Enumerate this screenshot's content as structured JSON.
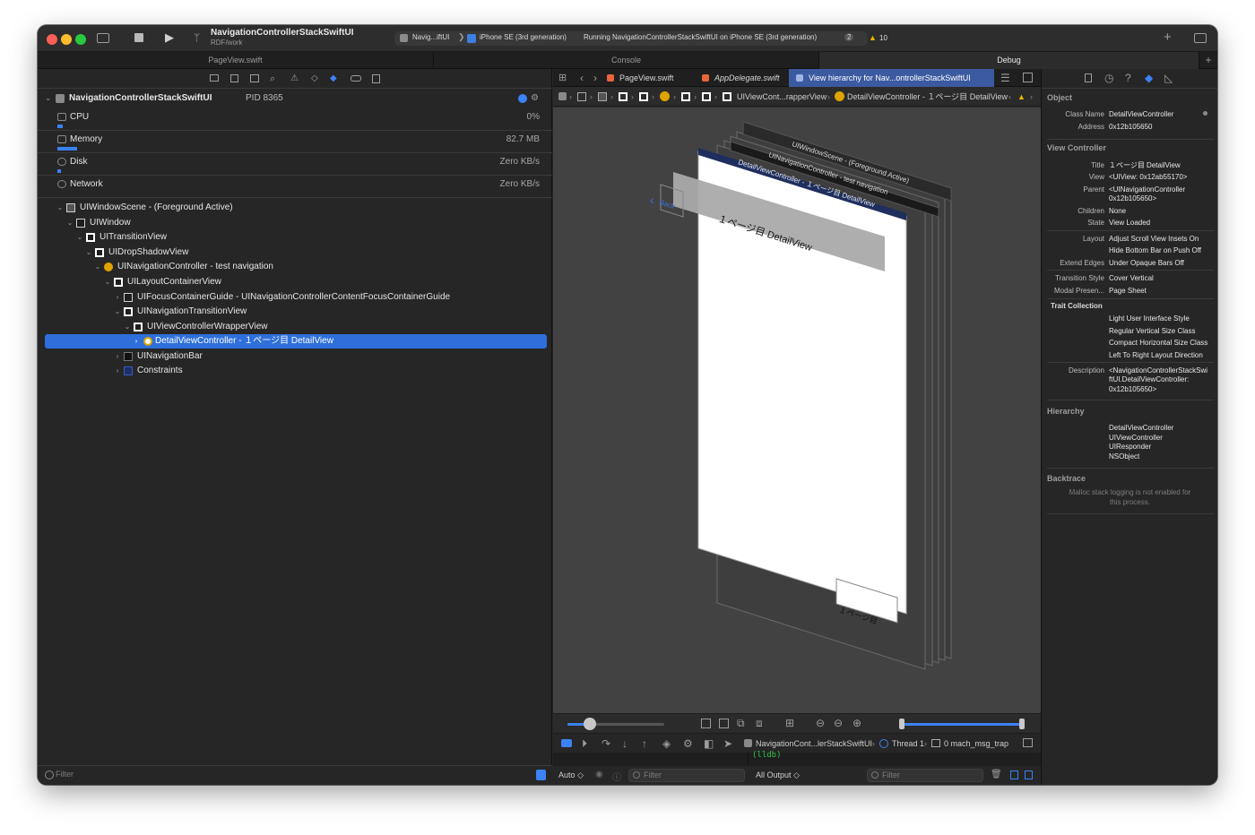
{
  "toolbar": {
    "project_name": "NavigationControllerStackSwiftUI",
    "project_branch": "RDF/work",
    "scheme_name": "Navig...iftUI",
    "destination": "iPhone SE (3rd generation)",
    "status_text": "Running NavigationControllerStackSwiftUI on iPhone SE (3rd generation)",
    "status_count": "2",
    "warning_count": "10"
  },
  "top_tabs": [
    {
      "label": "PageView.swift"
    },
    {
      "label": "Console"
    },
    {
      "label": "Debug"
    }
  ],
  "debug_nav": {
    "process_name": "NavigationControllerStackSwiftUI",
    "process_pid": "PID 8365",
    "gauges": [
      {
        "label": "CPU",
        "value": "0%"
      },
      {
        "label": "Memory",
        "value": "82.7 MB"
      },
      {
        "label": "Disk",
        "value": "Zero KB/s"
      },
      {
        "label": "Network",
        "value": "Zero KB/s"
      }
    ],
    "tree": [
      {
        "label": "UIWindowScene - (Foreground Active)"
      },
      {
        "label": "UIWindow"
      },
      {
        "label": "UITransitionView"
      },
      {
        "label": "UIDropShadowView"
      },
      {
        "label": "UINavigationController - test navigation"
      },
      {
        "label": "UILayoutContainerView"
      },
      {
        "label": "UIFocusContainerGuide - UINavigationControllerContentFocusContainerGuide"
      },
      {
        "label": "UINavigationTransitionView"
      },
      {
        "label": "UIViewControllerWrapperView"
      },
      {
        "label": "DetailViewController - １ページ目 DetailView"
      },
      {
        "label": "UINavigationBar"
      },
      {
        "label": "Constraints"
      }
    ],
    "filter_placeholder": "Filter"
  },
  "editor": {
    "tabs": [
      {
        "label": "PageView.swift"
      },
      {
        "label": "AppDelegate.swift"
      },
      {
        "label": "View hierarchy for Nav...ontrollerStackSwiftUI"
      }
    ],
    "jump_bar": [
      {
        "label": "UIViewCont...rapperView"
      },
      {
        "label": "DetailViewController - １ページ目 DetailView"
      }
    ],
    "scene_labels": {
      "window_scene": "UIWindowScene - (Foreground Active)",
      "nav_controller": "UINavigationController - test navigation",
      "detail_vc": "DetailViewController - １ページ目 DetailView",
      "title_text": "１ページ目 DetailView",
      "bottom_label": "１ページ目",
      "back_text": "Back"
    }
  },
  "debug_bar": {
    "process": "NavigationCont...lerStackSwiftUI",
    "thread": "Thread 1",
    "frame": "0 mach_msg_trap"
  },
  "console": {
    "prompt": "(lldb)",
    "var_mode": "Auto ◇",
    "output_mode": "All Output ◇",
    "filter_placeholder": "Filter"
  },
  "inspector": {
    "object_header": "Object",
    "object": [
      {
        "k": "Class Name",
        "v": "DetailViewController"
      },
      {
        "k": "Address",
        "v": "0x12b105650"
      }
    ],
    "vc_header": "View Controller",
    "vc": [
      {
        "k": "Title",
        "v": "１ページ目 DetailView"
      },
      {
        "k": "View",
        "v": "<UIView: 0x12ab55170>"
      },
      {
        "k": "Parent",
        "v": "<UINavigationController"
      },
      {
        "k": "",
        "v": "0x12b105650>"
      },
      {
        "k": "Children",
        "v": "None"
      },
      {
        "k": "State",
        "v": "View Loaded"
      },
      {
        "k": "Layout",
        "v": "Adjust Scroll View Insets On"
      },
      {
        "k": "",
        "v": "Hide Bottom Bar on Push Off"
      },
      {
        "k": "Extend Edges",
        "v": "Under Opaque Bars Off"
      },
      {
        "k": "Transition Style",
        "v": "Cover Vertical"
      },
      {
        "k": "Modal Presen...",
        "v": "Page Sheet"
      }
    ],
    "trait_header": "Trait Collection",
    "traits": [
      "Light User Interface Style",
      "Regular Vertical Size Class",
      "Compact Horizontal Size Class",
      "Left To Right Layout Direction"
    ],
    "description_key": "Description",
    "description_lines": [
      "<NavigationControllerStackSwi",
      "ftUI.DetailViewController:",
      "0x12b105650>"
    ],
    "hierarchy_header": "Hierarchy",
    "hierarchy": [
      "DetailViewController",
      "UIViewController",
      "UIResponder",
      "NSObject"
    ],
    "backtrace_header": "Backtrace",
    "backtrace_note_1": "Malloc stack logging is not enabled for",
    "backtrace_note_2": "this process."
  },
  "colors": {
    "accent": "#2e6fdb",
    "warning": "#f0b400",
    "console_green": "#33c24a"
  }
}
